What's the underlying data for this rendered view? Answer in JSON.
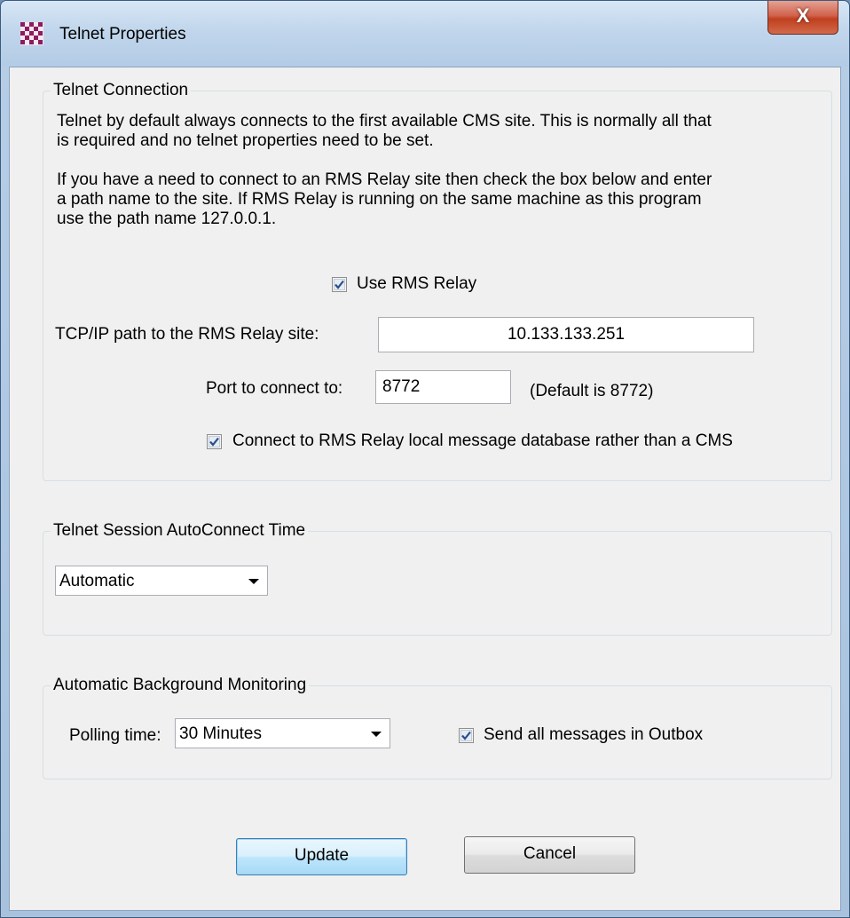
{
  "window": {
    "title": "Telnet Properties",
    "close_label": "X"
  },
  "telnet_connection": {
    "legend": "Telnet Connection",
    "intro_line1": "Telnet by default always connects to the first available CMS site. This is normally all that",
    "intro_line2": "is required and no telnet properties need to be set.",
    "relay_line1": "If you have a need to connect to an RMS Relay site then check the box below and enter",
    "relay_line2": "a path name to the site. If RMS Relay is running on the same machine as this program",
    "relay_line3": "use the path name 127.0.0.1.",
    "use_relay_label": "Use RMS Relay",
    "use_relay_checked": true,
    "path_label": "TCP/IP path to the RMS Relay site:",
    "path_value": "10.133.133.251",
    "port_label": "Port to connect to:",
    "port_value": "8772",
    "port_default_note": "(Default is 8772)",
    "local_db_label": "Connect to RMS Relay local message database rather than a CMS",
    "local_db_checked": true
  },
  "autoconnect": {
    "legend": "Telnet Session AutoConnect Time",
    "selected": "Automatic"
  },
  "monitoring": {
    "legend": "Automatic Background Monitoring",
    "polling_label": "Polling time:",
    "polling_selected": "30 Minutes",
    "send_all_label": "Send all messages in Outbox",
    "send_all_checked": true
  },
  "buttons": {
    "update": "Update",
    "cancel": "Cancel"
  },
  "colors": {
    "check_mark": "#2a4f8a",
    "default_button_border": "#3c7fb1",
    "close_button": "#c0401f"
  }
}
